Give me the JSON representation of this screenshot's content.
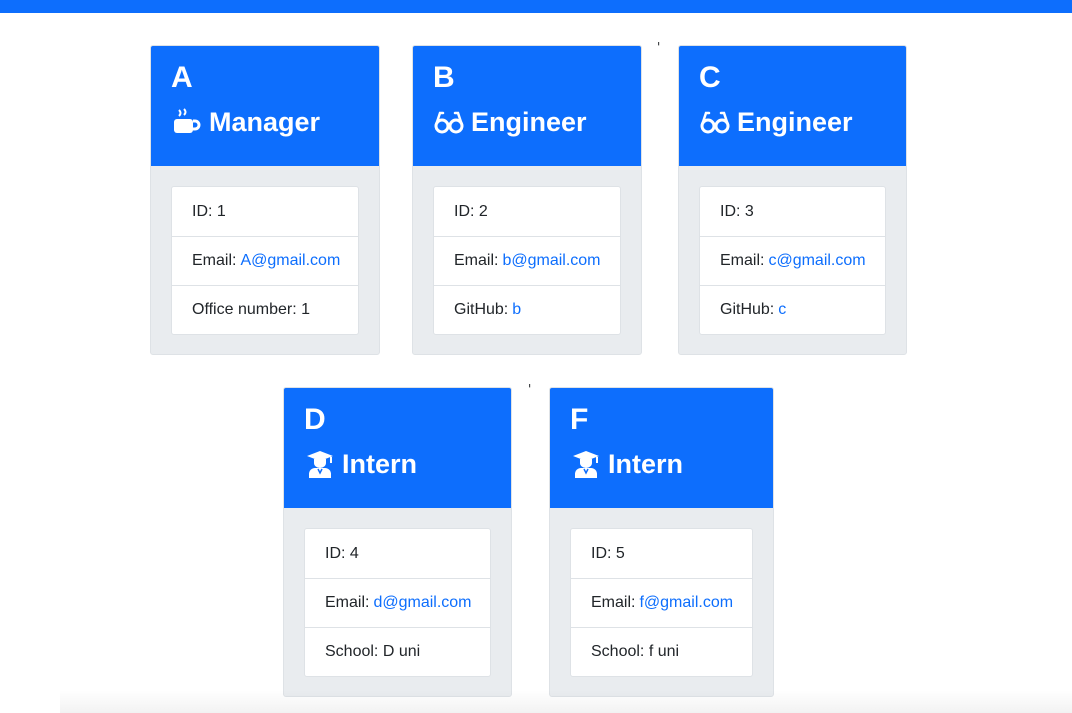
{
  "stray_marks": [
    "'",
    "'"
  ],
  "employees": [
    {
      "name": "A",
      "role": "Manager",
      "icon": "coffee-icon",
      "id_text": "ID: 1",
      "email_label": "Email:",
      "email": "A@gmail.com",
      "extra_label": "Office number: 1",
      "extra_link": ""
    },
    {
      "name": "B",
      "role": "Engineer",
      "icon": "glasses-icon",
      "id_text": "ID: 2",
      "email_label": "Email:",
      "email": "b@gmail.com",
      "extra_label": "GitHub:",
      "extra_link": "b"
    },
    {
      "name": "C",
      "role": "Engineer",
      "icon": "glasses-icon",
      "id_text": "ID: 3",
      "email_label": "Email:",
      "email": "c@gmail.com",
      "extra_label": "GitHub:",
      "extra_link": "c"
    },
    {
      "name": "D",
      "role": "Intern",
      "icon": "graduate-icon",
      "id_text": "ID: 4",
      "email_label": "Email:",
      "email": "d@gmail.com",
      "extra_label": "School: D uni",
      "extra_link": ""
    },
    {
      "name": "F",
      "role": "Intern",
      "icon": "graduate-icon",
      "id_text": "ID: 5",
      "email_label": "Email:",
      "email": "f@gmail.com",
      "extra_label": "School: f uni",
      "extra_link": ""
    }
  ],
  "colors": {
    "header": "#0d6efd",
    "card_body": "#e9ecef",
    "link": "#0d6efd"
  }
}
